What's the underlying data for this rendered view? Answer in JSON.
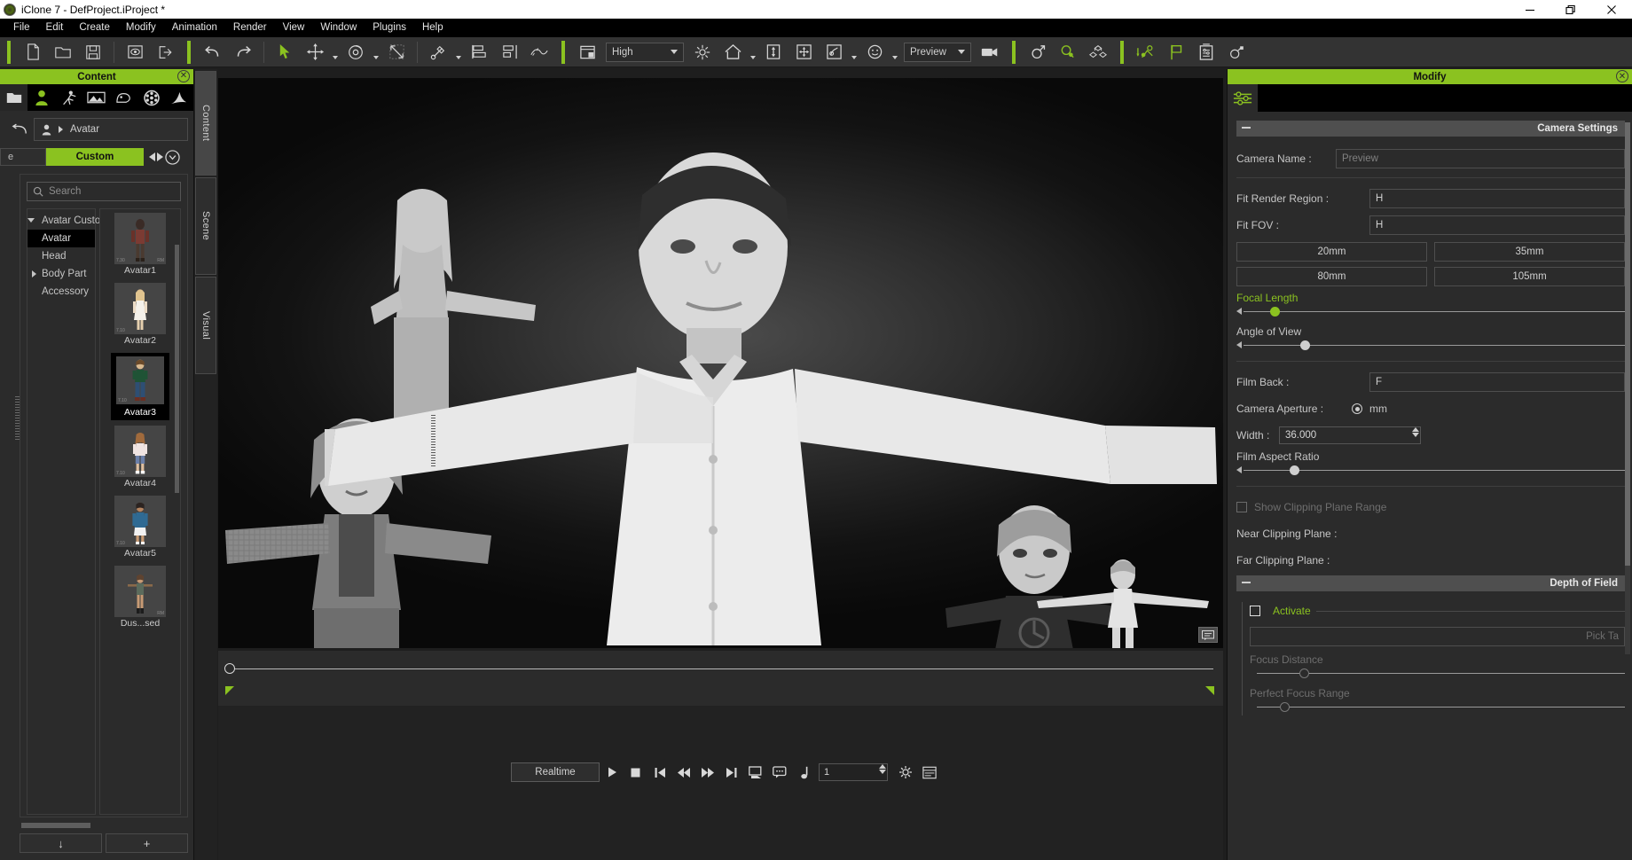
{
  "window": {
    "title": "iClone 7 - DefProject.iProject *",
    "app_icon": "iclone-logo-icon",
    "controls": {
      "minimize": "minimize-icon",
      "restore": "restore-icon",
      "close": "close-icon"
    }
  },
  "menu": {
    "items": [
      {
        "label": "File",
        "mnemonic": "F"
      },
      {
        "label": "Edit",
        "mnemonic": "E"
      },
      {
        "label": "Create",
        "mnemonic": "C"
      },
      {
        "label": "Modify",
        "mnemonic": "M"
      },
      {
        "label": "Animation",
        "mnemonic": "A"
      },
      {
        "label": "Render",
        "mnemonic": "R"
      },
      {
        "label": "View",
        "mnemonic": "V"
      },
      {
        "label": "Window",
        "mnemonic": "W"
      },
      {
        "label": "Plugins",
        "mnemonic": "P"
      },
      {
        "label": "Help",
        "mnemonic": "H"
      }
    ]
  },
  "toolbar": {
    "quality_value": "High",
    "render_mode_value": "Preview",
    "icons": [
      "new-project-icon",
      "open-project-icon",
      "save-project-icon",
      "load-preview-icon",
      "export-icon",
      "undo-icon",
      "redo-icon",
      "select-tool-icon",
      "move-tool-icon",
      "rotate-tool-icon",
      "scale-tool-icon",
      "link-tool-icon",
      "align-icon",
      "align-distribute-icon",
      "motion-path-icon",
      "viewport-layout-icon",
      "light-icon",
      "home-view-icon",
      "fit-vertical-icon",
      "fit-all-icon",
      "preview-quality-icon",
      "face-icon",
      "camera-icon",
      "male-gender-icon",
      "female-gender-icon",
      "props-icon",
      "motion-layer-icon",
      "flag-icon",
      "project-settings-icon",
      "transform-settings-icon"
    ]
  },
  "content_panel": {
    "title": "Content",
    "close_icon": "close-icon",
    "category_tabs": [
      {
        "name": "folder-tab-icon",
        "active": false
      },
      {
        "name": "avatar-tab-icon",
        "active": true
      },
      {
        "name": "motion-tab-icon",
        "active": false
      },
      {
        "name": "scene-tab-icon",
        "active": false
      },
      {
        "name": "prop-tab-icon",
        "active": false
      },
      {
        "name": "media-tab-icon",
        "active": false
      },
      {
        "name": "effects-tab-icon",
        "active": false
      }
    ],
    "back_icon": "back-arrow-icon",
    "breadcrumb": {
      "icon": "avatar-icon",
      "label": "Avatar"
    },
    "pack_left_label": "e",
    "custom_button": "Custom",
    "nav_prev_icon": "prev-arrow-icon",
    "nav_next_icon": "next-arrow-icon",
    "nav_more_icon": "chevron-down-circle-icon",
    "search": {
      "placeholder": "Search",
      "value": "",
      "icon": "search-icon"
    },
    "tree": [
      {
        "label": "Avatar Custom",
        "level": 0,
        "expanded": true,
        "selected": false
      },
      {
        "label": "Avatar",
        "level": 1,
        "expanded": null,
        "selected": true
      },
      {
        "label": "Head",
        "level": 1,
        "expanded": null,
        "selected": false
      },
      {
        "label": "Body Part",
        "level": 1,
        "expanded": false,
        "selected": false
      },
      {
        "label": "Accessory",
        "level": 1,
        "expanded": null,
        "selected": false
      }
    ],
    "thumbnails": [
      {
        "label": "Avatar1",
        "selected": false,
        "tag_left": "7.30",
        "tag_right": "RM"
      },
      {
        "label": "Avatar2",
        "selected": false,
        "tag_left": "7.10",
        "tag_right": ""
      },
      {
        "label": "Avatar3",
        "selected": true,
        "tag_left": "7.10",
        "tag_right": ""
      },
      {
        "label": "Avatar4",
        "selected": false,
        "tag_left": "7.10",
        "tag_right": ""
      },
      {
        "label": "Avatar5",
        "selected": false,
        "tag_left": "7.10",
        "tag_right": ""
      },
      {
        "label": "Dus...sed",
        "selected": false,
        "tag_left": "",
        "tag_right": "RM"
      }
    ],
    "footer_buttons": [
      {
        "name": "download-button",
        "glyph": "↓"
      },
      {
        "name": "add-button",
        "glyph": "+"
      }
    ]
  },
  "side_tabs": [
    {
      "label": "Content",
      "active": true
    },
    {
      "label": "Scene",
      "active": false
    },
    {
      "label": "Visual",
      "active": false
    }
  ],
  "viewport": {
    "message_icon": "viewport-message-icon",
    "resize_handle": "panel-resize-handle",
    "figures": [
      {
        "name": "female-avatar-back",
        "description": "blonde woman T-pose"
      },
      {
        "name": "male-avatar-center",
        "description": "man in white shirt T-pose"
      },
      {
        "name": "female-avatar-left",
        "description": "woman in knit cardigan T-pose"
      },
      {
        "name": "boy-avatar-right",
        "description": "boy in dark tee T-pose"
      },
      {
        "name": "child-avatar-far-right",
        "description": "small child T-pose"
      }
    ]
  },
  "timeline": {
    "playhead_position": 0,
    "start_marker": "range-start-marker",
    "end_marker": "range-end-marker"
  },
  "transport": {
    "realtime_label": "Realtime",
    "buttons": [
      {
        "name": "play-button",
        "glyph": "play"
      },
      {
        "name": "stop-button",
        "glyph": "stop"
      },
      {
        "name": "goto-start-button",
        "glyph": "skip-back"
      },
      {
        "name": "rewind-button",
        "glyph": "rewind"
      },
      {
        "name": "fast-forward-button",
        "glyph": "forward"
      },
      {
        "name": "goto-end-button",
        "glyph": "skip-forward"
      },
      {
        "name": "screen-capture-button",
        "glyph": "screen"
      },
      {
        "name": "subtitle-button",
        "glyph": "caption"
      },
      {
        "name": "audio-button",
        "glyph": "note"
      }
    ],
    "frame_value": "1",
    "settings_icon": "gear-icon",
    "timeline_icon": "timeline-icon"
  },
  "modify_panel": {
    "title": "Modify",
    "close_icon": "close-icon",
    "tab_icon": "sliders-icon",
    "group_camera": "Camera Settings",
    "camera_name": {
      "label": "Camera Name :",
      "placeholder": "Preview",
      "value": ""
    },
    "fit_render_region": {
      "label": "Fit Render Region :",
      "value": "H"
    },
    "fit_fov": {
      "label": "Fit FOV :",
      "value": "H"
    },
    "focal_presets": [
      "20mm",
      "35mm",
      "80mm",
      "105mm"
    ],
    "focal_length": {
      "label": "Focal Length",
      "knob_pct": 18
    },
    "angle_of_view": {
      "label": "Angle of View",
      "knob_pct": 40
    },
    "film_back": {
      "label": "Film Back :",
      "value": "F"
    },
    "camera_aperture": {
      "label": "Camera Aperture :",
      "unit": "mm"
    },
    "width": {
      "label": "Width :",
      "value": "36.000"
    },
    "film_aspect_ratio": {
      "label": "Film Aspect Ratio",
      "knob_pct": 37
    },
    "show_clipping_plane_range": {
      "label": "Show Clipping Plane Range",
      "checked": false
    },
    "near_clipping_plane": {
      "label": "Near Clipping Plane :"
    },
    "far_clipping_plane": {
      "label": "Far Clipping Plane :"
    },
    "group_dof": "Depth of Field",
    "activate": {
      "label": "Activate",
      "checked": false
    },
    "pick_target": {
      "placeholder": "Pick Ta"
    },
    "focus_distance": {
      "label": "Focus Distance",
      "knob_pct": 28
    },
    "perfect_focus_range": {
      "label": "Perfect Focus Range",
      "knob_pct": 17
    }
  },
  "colors": {
    "accent_green": "#8bc220",
    "panel_bg": "#2b2b2b",
    "toolbar_bg": "#333333",
    "menubar_bg": "#000000",
    "titlebar_bg": "#ffffff"
  }
}
